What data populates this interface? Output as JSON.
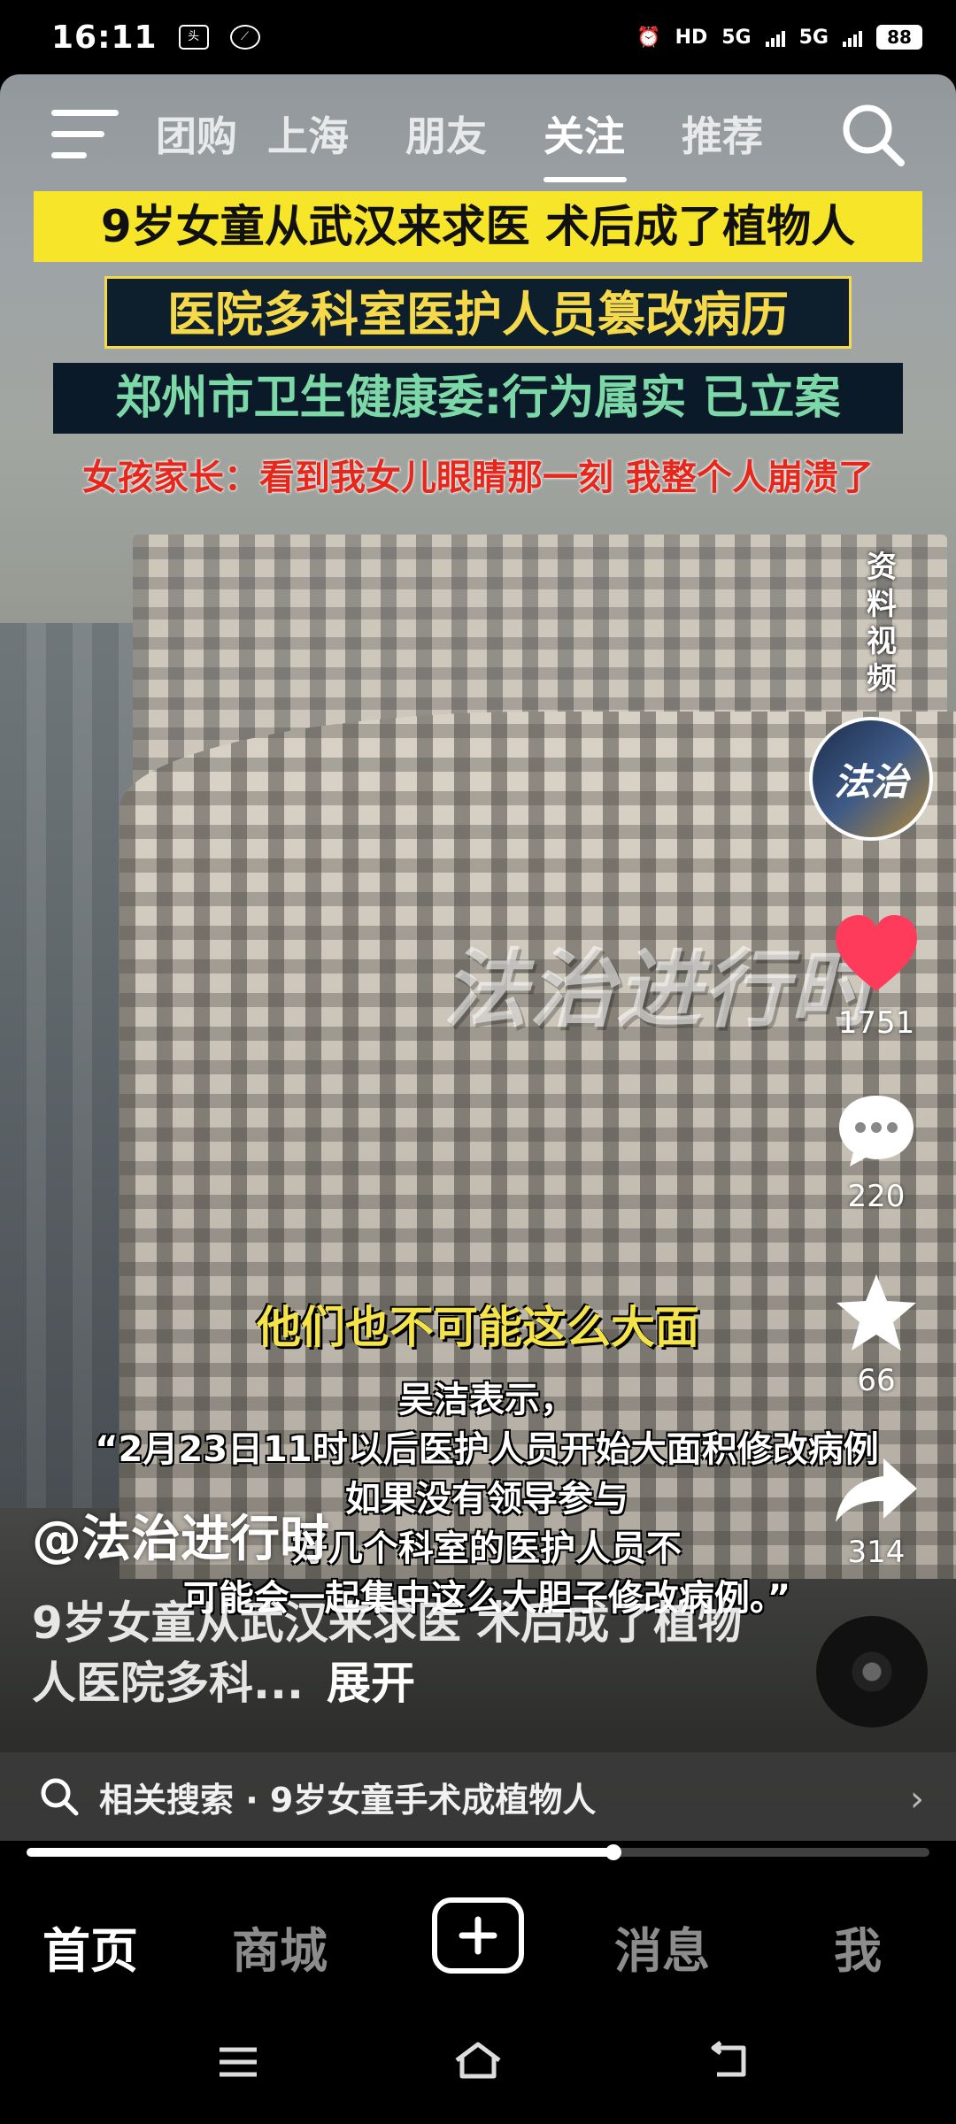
{
  "status_bar": {
    "time": "16:11",
    "battery": "88",
    "network_1": "5G",
    "network_2": "5G",
    "hd": "HD"
  },
  "top_tabs": {
    "items": [
      "团购",
      "上海",
      "朋友",
      "关注",
      "推荐"
    ],
    "active_index": 3
  },
  "headlines": {
    "line1": "9岁女童从武汉来求医 术后成了植物人",
    "line2": "医院多科室医护人员篡改病历",
    "line3": "郑州市卫生健康委:行为属实 已立案",
    "line4": "女孩家长：看到我女儿眼睛那一刻 我整个人崩溃了"
  },
  "side_note": "资料视频",
  "avatar_text": "法治",
  "watermark": "法治进行时",
  "actions": {
    "likes": "1751",
    "comments": "220",
    "favorites": "66",
    "shares": "314"
  },
  "subtitle": "他们也不可能这么大面",
  "quote_lines": [
    "吴洁表示，",
    "“2月23日11时以后医护人员开始大面积修改病例",
    "如果没有领导参与",
    "好几个科室的医护人员不",
    "可能会一起集中这么大胆子修改病例。”"
  ],
  "author": "@法治进行时",
  "description": "9岁女童从武汉来求医 术后成了植物人医院多科...",
  "expand_label": "展开",
  "related": {
    "prefix": "相关搜索",
    "separator": "·",
    "query": "9岁女童手术成植物人"
  },
  "progress": 0.65,
  "bottom_nav": [
    "首页",
    "商城",
    "消息",
    "我"
  ],
  "colors": {
    "headline1_bg": "#f7e52a",
    "headline2_text": "#f5d94a",
    "headline3_text": "#7dd8a8",
    "headline4_text": "#e7271c",
    "heart": "#ff3b5c",
    "subtitle": "#f4e44a"
  },
  "icons": [
    "menu-icon",
    "search-icon",
    "heart-icon",
    "comment-icon",
    "star-icon",
    "share-icon",
    "music-disc-icon",
    "plus-icon",
    "chevron-right-icon",
    "home-icon",
    "back-icon",
    "recents-icon"
  ]
}
